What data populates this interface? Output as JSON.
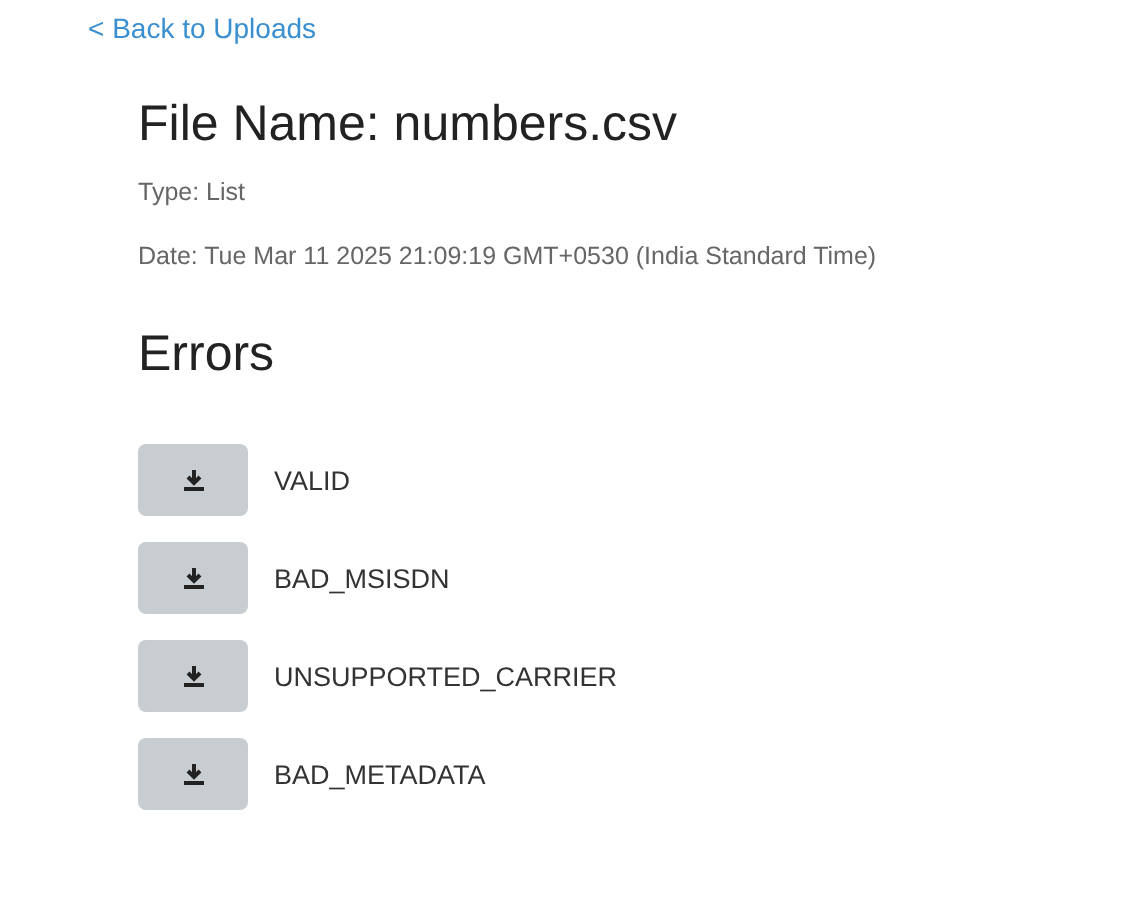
{
  "back_link": "< Back to Uploads",
  "file": {
    "title": "File Name: numbers.csv",
    "type": "Type: List",
    "date": "Date: Tue Mar 11 2025 21:09:19 GMT+0530 (India Standard Time)"
  },
  "errors": {
    "heading": "Errors",
    "items": [
      {
        "label": "VALID"
      },
      {
        "label": "BAD_MSISDN"
      },
      {
        "label": "UNSUPPORTED_CARRIER"
      },
      {
        "label": "BAD_METADATA"
      }
    ]
  }
}
